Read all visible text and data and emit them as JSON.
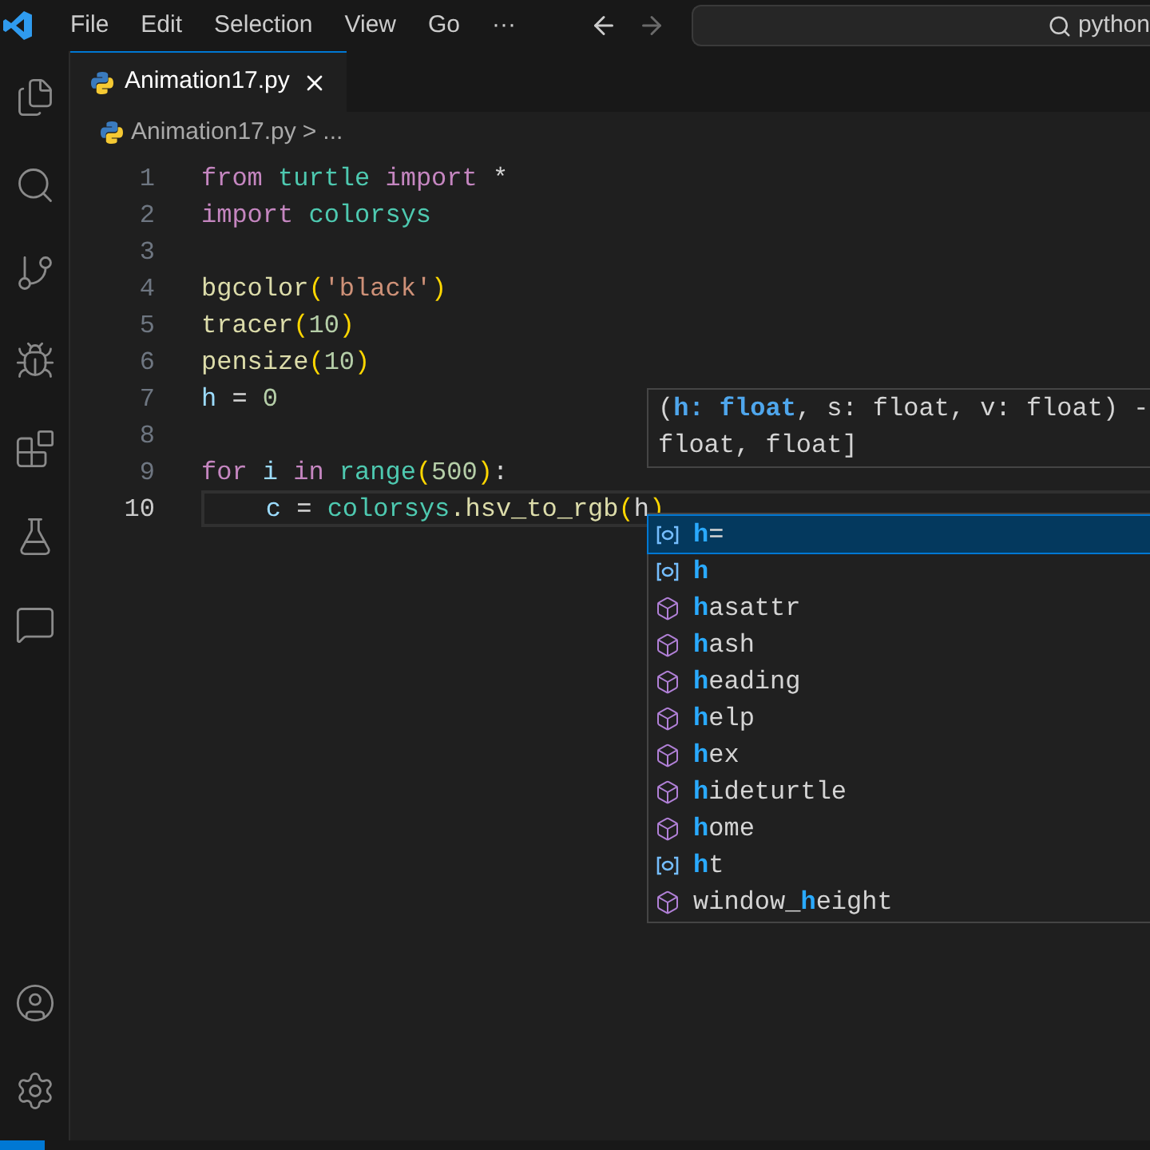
{
  "menu": [
    "File",
    "Edit",
    "Selection",
    "View",
    "Go",
    "···"
  ],
  "search": {
    "value": "python"
  },
  "tabs": [
    {
      "label": "Animation17.py",
      "selected": true
    }
  ],
  "breadcrumbs": [
    "Animation17.py",
    ">",
    "..."
  ],
  "code": [
    {
      "number": "1",
      "current": false,
      "tokens": [
        {
          "text": "from ",
          "kind": "keyword"
        },
        {
          "text": "turtle ",
          "kind": "module"
        },
        {
          "text": "import ",
          "kind": "keyword"
        },
        {
          "text": "*",
          "kind": "plain"
        }
      ]
    },
    {
      "number": "2",
      "current": false,
      "tokens": [
        {
          "text": "import ",
          "kind": "keyword"
        },
        {
          "text": "colorsys",
          "kind": "module"
        }
      ]
    },
    {
      "number": "3",
      "current": false
    },
    {
      "number": "4",
      "current": false,
      "tokens": [
        {
          "text": "bgcolor",
          "kind": "func"
        },
        {
          "text": "(",
          "kind": "paren"
        },
        {
          "text": "'black'",
          "kind": "string"
        },
        {
          "text": ")",
          "kind": "paren"
        }
      ]
    },
    {
      "number": "5",
      "current": false,
      "tokens": [
        {
          "text": "tracer",
          "kind": "func"
        },
        {
          "text": "(",
          "kind": "paren"
        },
        {
          "text": "10",
          "kind": "number"
        },
        {
          "text": ")",
          "kind": "paren"
        }
      ]
    },
    {
      "number": "6",
      "current": false,
      "tokens": [
        {
          "text": "pensize",
          "kind": "func"
        },
        {
          "text": "(",
          "kind": "paren"
        },
        {
          "text": "10",
          "kind": "number"
        },
        {
          "text": ")",
          "kind": "paren"
        }
      ]
    },
    {
      "number": "7",
      "current": false,
      "tokens": [
        {
          "text": "h",
          "kind": "var"
        },
        {
          "text": " = ",
          "kind": "plain"
        },
        {
          "text": "0",
          "kind": "number"
        }
      ]
    },
    {
      "number": "8",
      "current": false
    },
    {
      "number": "9",
      "current": false,
      "tokens": [
        {
          "text": "for ",
          "kind": "keyword"
        },
        {
          "text": "i ",
          "kind": "var"
        },
        {
          "text": "in ",
          "kind": "keyword"
        },
        {
          "text": "range",
          "kind": "module"
        },
        {
          "text": "(",
          "kind": "paren"
        },
        {
          "text": "500",
          "kind": "number"
        },
        {
          "text": ")",
          "kind": "paren"
        },
        {
          "text": ":",
          "kind": "plain"
        }
      ]
    },
    {
      "number": "10",
      "current": true,
      "tokens": [
        {
          "text": "    c",
          "kind": "var"
        },
        {
          "text": " = ",
          "kind": "plain"
        },
        {
          "text": "colorsys",
          "kind": "module"
        },
        {
          "text": ".hsv_to_rgb",
          "kind": "func"
        },
        {
          "text": "(",
          "kind": "paren"
        },
        {
          "text": "h",
          "kind": "plain"
        },
        {
          "text": ")",
          "kind": "paren"
        }
      ]
    }
  ],
  "signature_hint": {
    "lines": [
      [
        {
          "text": "(",
          "kind": "plain"
        },
        {
          "text": "h: float",
          "kind": "active"
        },
        {
          "text": ", s: float, v: float) -",
          "kind": "plain"
        }
      ],
      [
        {
          "text": "float, float]",
          "kind": "plain"
        }
      ]
    ]
  },
  "suggestions": [
    {
      "kind": "variable",
      "match": "h",
      "after": "=",
      "selected": true
    },
    {
      "kind": "variable",
      "match": "h",
      "selected": false
    },
    {
      "kind": "module",
      "match": "h",
      "after": "asattr",
      "selected": false
    },
    {
      "kind": "module",
      "match": "h",
      "after": "ash",
      "selected": false
    },
    {
      "kind": "module",
      "match": "h",
      "after": "eading",
      "selected": false
    },
    {
      "kind": "module",
      "match": "h",
      "after": "elp",
      "selected": false
    },
    {
      "kind": "module",
      "match": "h",
      "after": "ex",
      "selected": false
    },
    {
      "kind": "module",
      "match": "h",
      "after": "ideturtle",
      "selected": false
    },
    {
      "kind": "module",
      "match": "h",
      "after": "ome",
      "selected": false
    },
    {
      "kind": "variable",
      "match": "h",
      "after": "t",
      "selected": false
    },
    {
      "kind": "module",
      "before": "window_",
      "match": "h",
      "after": "eight",
      "selected": false
    }
  ]
}
